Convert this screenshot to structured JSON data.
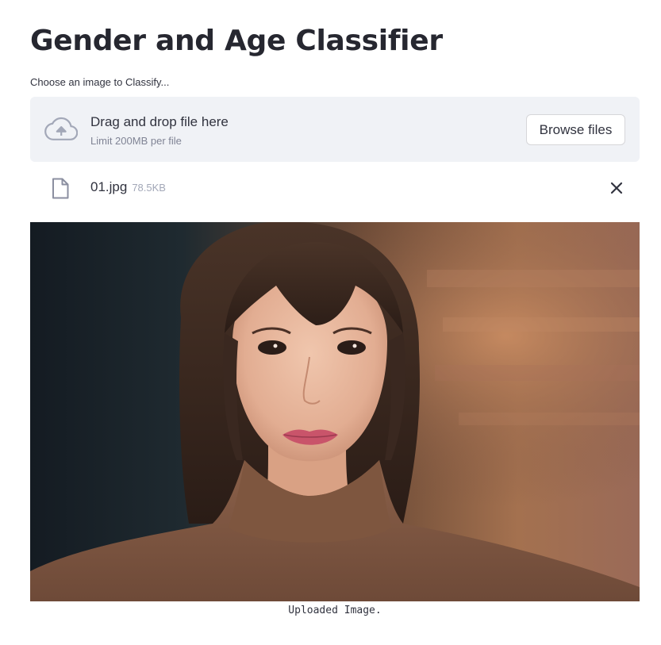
{
  "page": {
    "title": "Gender and Age Classifier"
  },
  "uploader": {
    "label": "Choose an image to Classify...",
    "drag_text": "Drag and drop file here",
    "limit_text": "Limit 200MB per file",
    "browse_label": "Browse files",
    "cloud_icon": "cloud-upload-icon"
  },
  "uploaded_file": {
    "name": "01.jpg",
    "size": "78.5KB",
    "file_icon": "file-icon",
    "remove_icon": "close-icon"
  },
  "image": {
    "caption": "Uploaded Image.",
    "subject": "portrait-photo"
  },
  "colors": {
    "text": "#262730",
    "dropzone_bg": "#f0f2f6",
    "muted": "#808495"
  }
}
